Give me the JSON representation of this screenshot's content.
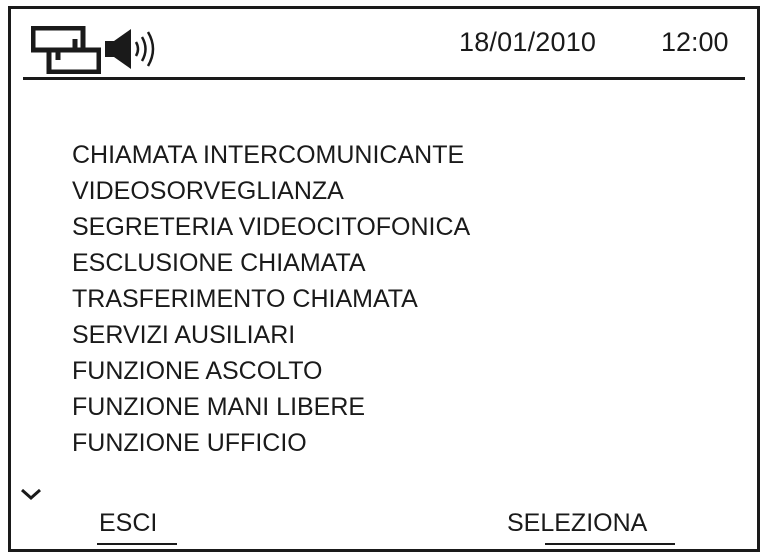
{
  "status": {
    "network_icon": "network-icon",
    "speaker_icon": "speaker-icon",
    "date": "18/01/2010",
    "time": "12:00"
  },
  "menu": {
    "items": [
      {
        "label": "CHIAMATA INTERCOMUNICANTE"
      },
      {
        "label": "VIDEOSORVEGLIANZA"
      },
      {
        "label": "SEGRETERIA VIDEOCITOFONICA"
      },
      {
        "label": "ESCLUSIONE CHIAMATA"
      },
      {
        "label": "TRASFERIMENTO CHIAMATA"
      },
      {
        "label": "SERVIZI AUSILIARI"
      },
      {
        "label": "FUNZIONE ASCOLTO"
      },
      {
        "label": "FUNZIONE MANI LIBERE"
      },
      {
        "label": "FUNZIONE UFFICIO"
      }
    ],
    "scroll_icon": "chevron-down-icon"
  },
  "softkeys": {
    "exit_label": "ESCI",
    "select_label": "SELEZIONA"
  },
  "colors": {
    "foreground": "#1a1a1a",
    "background": "#ffffff"
  }
}
